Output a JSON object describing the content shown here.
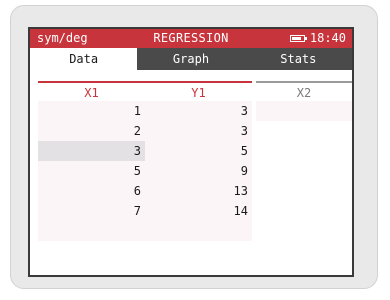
{
  "status": {
    "mode": "sym/deg",
    "title": "REGRESSION",
    "battery_icon": "battery-icon",
    "time": "18:40"
  },
  "tabs": [
    {
      "label": "Data",
      "active": true
    },
    {
      "label": "Graph",
      "active": false
    },
    {
      "label": "Stats",
      "active": false
    }
  ],
  "table": {
    "columns": [
      "X1",
      "Y1",
      "X2"
    ],
    "rows": [
      {
        "x": "1",
        "y": "3"
      },
      {
        "x": "2",
        "y": "3"
      },
      {
        "x": "3",
        "y": "5"
      },
      {
        "x": "5",
        "y": "9"
      },
      {
        "x": "6",
        "y": "13"
      },
      {
        "x": "7",
        "y": "14"
      }
    ],
    "selected_row": 2
  },
  "scrollbar": {
    "position_fraction": 0.48
  },
  "colors": {
    "accent": "#c8343c",
    "tab_bar": "#4a4a4a"
  }
}
